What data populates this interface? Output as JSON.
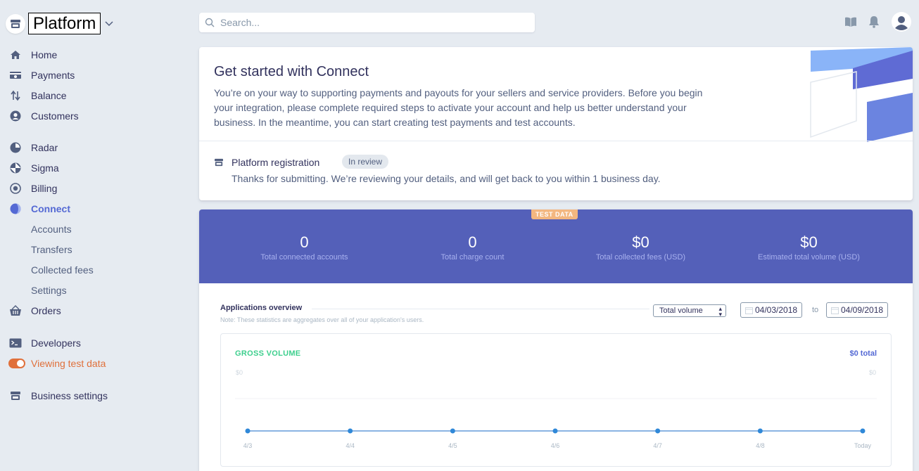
{
  "brand": {
    "name": "Platform"
  },
  "nav": {
    "home": "Home",
    "payments": "Payments",
    "balance": "Balance",
    "customers": "Customers",
    "radar": "Radar",
    "sigma": "Sigma",
    "billing": "Billing",
    "connect": "Connect",
    "accounts": "Accounts",
    "transfers": "Transfers",
    "collected_fees": "Collected fees",
    "settings": "Settings",
    "orders": "Orders",
    "developers": "Developers",
    "viewing_test_data": "Viewing test data",
    "business_settings": "Business settings"
  },
  "search": {
    "placeholder": "Search..."
  },
  "getting_started": {
    "title": "Get started with Connect",
    "text": "You’re on your way to supporting payments and payouts for your sellers and service providers. Before you begin your integration, please complete required steps to activate your account and help us better understand your business. In the meantime, you can start creating test payments and test accounts."
  },
  "registration": {
    "title": "Platform registration",
    "badge": "In review",
    "text": "Thanks for submitting. We’re reviewing your details, and will get back to you within 1 business day."
  },
  "stats": {
    "test_badge": "TEST DATA",
    "items": [
      {
        "value": "0",
        "label": "Total connected accounts"
      },
      {
        "value": "0",
        "label": "Total charge count"
      },
      {
        "value": "$0",
        "label": "Total collected fees (USD)"
      },
      {
        "value": "$0",
        "label": "Estimated total volume (USD)"
      }
    ]
  },
  "overview": {
    "title": "Applications overview",
    "note": "Note: These statistics are aggregates over all of your application's users.",
    "select_value": "Total volume",
    "date_from": "04/03/2018",
    "date_to": "04/09/2018",
    "to_label": "to"
  },
  "chart_data": {
    "type": "line",
    "title": "GROSS VOLUME",
    "total": "$0 total",
    "y_left_label": "$0",
    "y_right_label": "$0",
    "categories": [
      "4/3",
      "4/4",
      "4/5",
      "4/6",
      "4/7",
      "4/8",
      "Today"
    ],
    "series": [
      {
        "values": [
          0,
          0,
          0,
          0,
          0,
          0,
          0
        ]
      }
    ],
    "ylim": [
      0,
      0
    ],
    "colors": {
      "line": "#8ab4e3",
      "point": "#2f88d8",
      "grid": "#f0f2f5"
    }
  },
  "colors": {
    "accent": "#5469d4",
    "stats_bg": "#5460b9",
    "test_orange": "#e0703b",
    "gross_green": "#3ecf8e"
  }
}
